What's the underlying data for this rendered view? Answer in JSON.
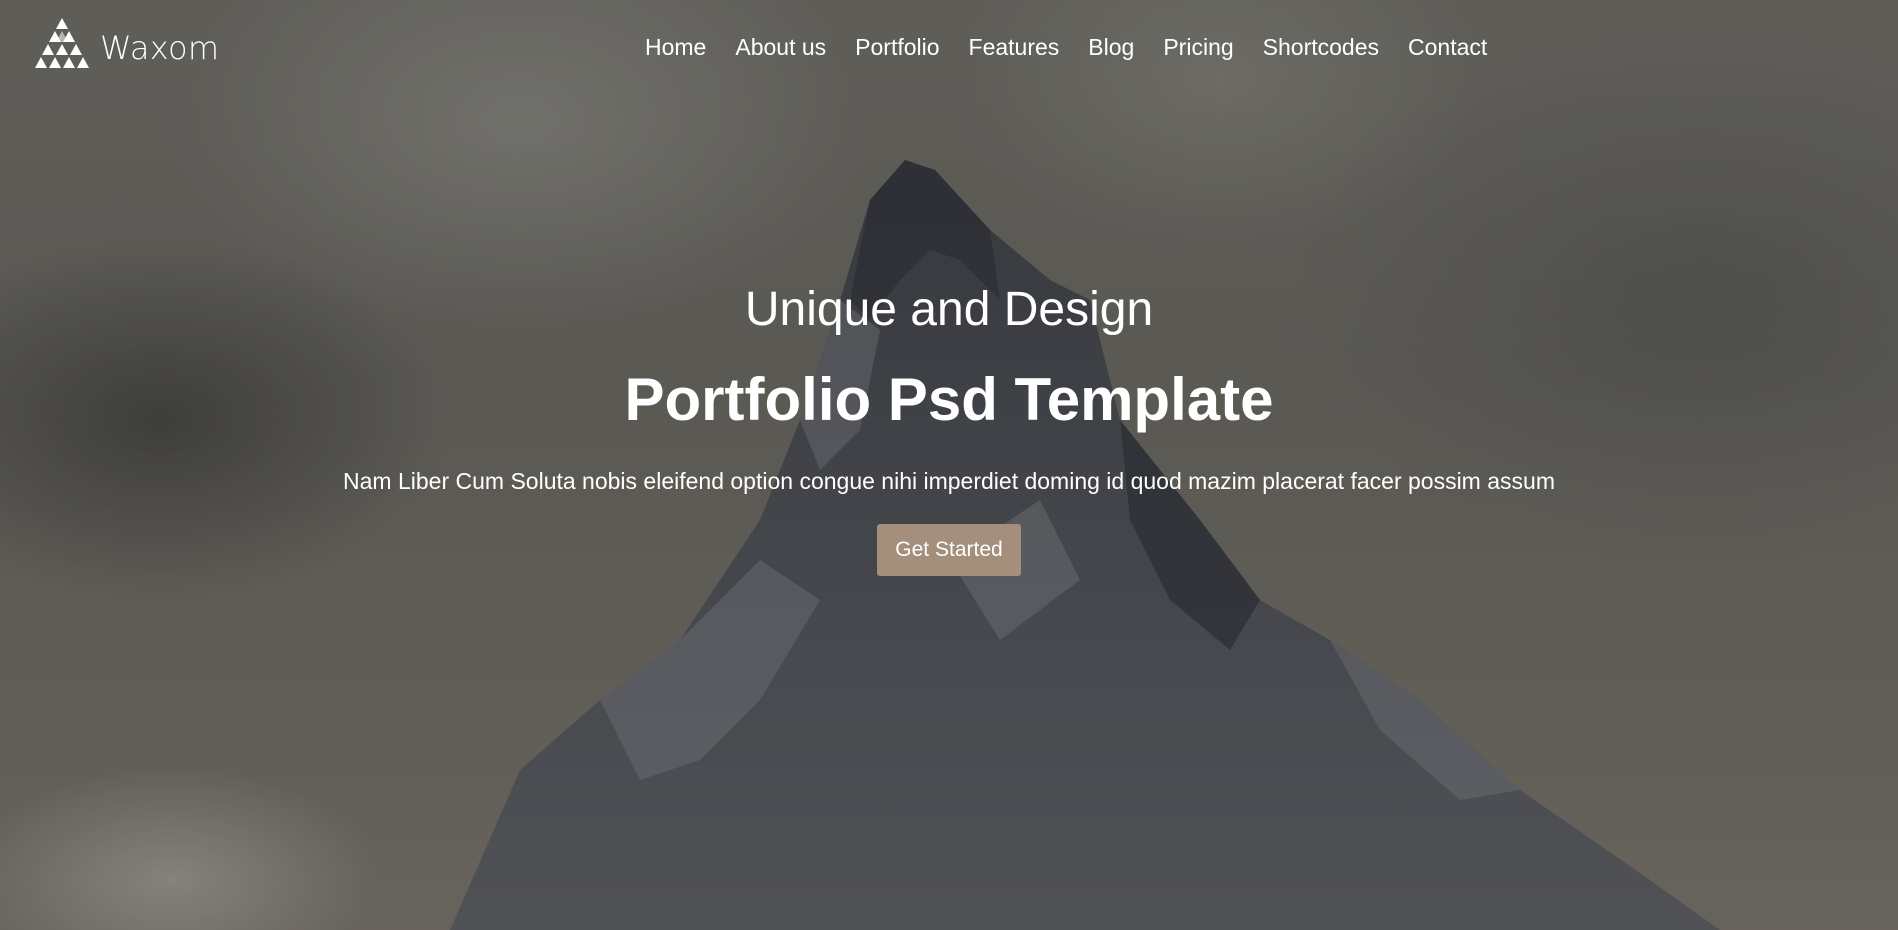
{
  "brand": {
    "name": "Waxom",
    "logo_icon": "triangle-mosaic-logo"
  },
  "nav": {
    "items": [
      {
        "label": "Home"
      },
      {
        "label": "About us"
      },
      {
        "label": "Portfolio"
      },
      {
        "label": "Features"
      },
      {
        "label": "Blog"
      },
      {
        "label": "Pricing"
      },
      {
        "label": "Shortcodes"
      },
      {
        "label": "Contact"
      }
    ]
  },
  "hero": {
    "subtitle": "Unique and Design",
    "title": "Portfolio Psd Template",
    "description": "Nam Liber Cum Soluta nobis eleifend option congue nihi imperdiet doming id quod mazim placerat facer possim assum",
    "cta_label": "Get Started",
    "background": "snowy-mountain-peak-photo"
  },
  "colors": {
    "accent": "#a48e7c",
    "text": "#ffffff"
  }
}
